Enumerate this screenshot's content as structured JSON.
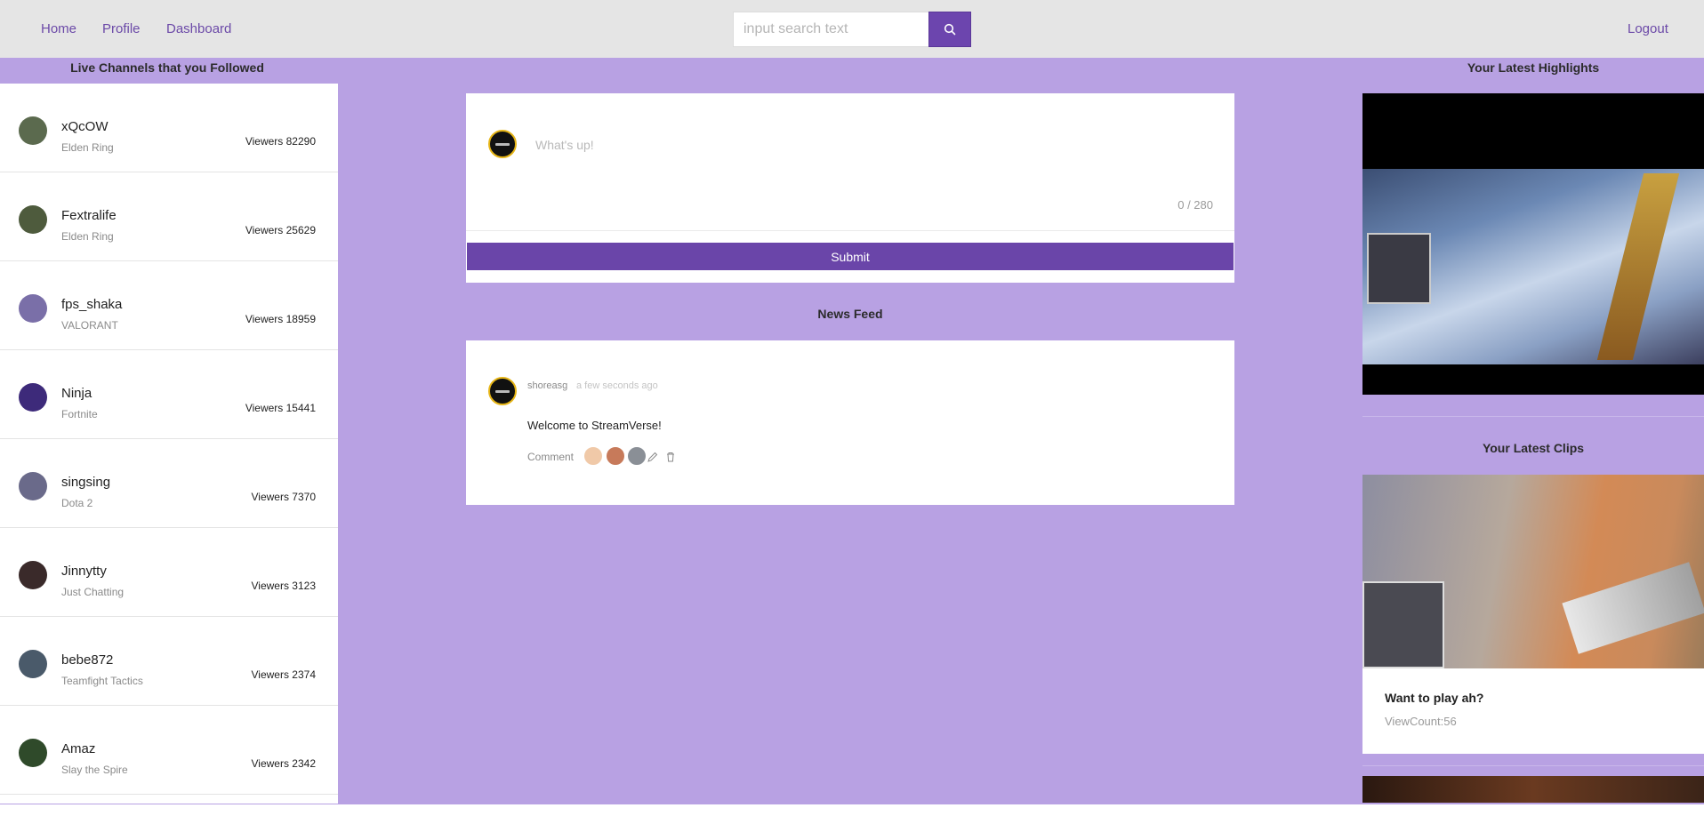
{
  "nav": {
    "home": "Home",
    "profile": "Profile",
    "dashboard": "Dashboard",
    "logout": "Logout",
    "search_placeholder": "input search text",
    "search_icon": "search-icon"
  },
  "sidebar": {
    "title": "Live Channels that you Followed",
    "channels": [
      {
        "name": "xQcOW",
        "game": "Elden Ring",
        "viewers": "Viewers 82290",
        "avatar_color": "#5b6a4e"
      },
      {
        "name": "Fextralife",
        "game": "Elden Ring",
        "viewers": "Viewers 25629",
        "avatar_color": "#4e5b3d"
      },
      {
        "name": "fps_shaka",
        "game": "VALORANT",
        "viewers": "Viewers 18959",
        "avatar_color": "#7a6fa8"
      },
      {
        "name": "Ninja",
        "game": "Fortnite",
        "viewers": "Viewers 15441",
        "avatar_color": "#3d2a7a"
      },
      {
        "name": "singsing",
        "game": "Dota 2",
        "viewers": "Viewers 7370",
        "avatar_color": "#6a6a8a"
      },
      {
        "name": "Jinnytty",
        "game": "Just Chatting",
        "viewers": "Viewers 3123",
        "avatar_color": "#3a2a2a"
      },
      {
        "name": "bebe872",
        "game": "Teamfight Tactics",
        "viewers": "Viewers 2374",
        "avatar_color": "#4a5a6a"
      },
      {
        "name": "Amaz",
        "game": "Slay the Spire",
        "viewers": "Viewers 2342",
        "avatar_color": "#2f4a2a"
      }
    ]
  },
  "composer": {
    "placeholder": "What's up!",
    "char_count": "0 / 280",
    "submit_label": "Submit"
  },
  "feed": {
    "title": "News Feed",
    "posts": [
      {
        "author": "shoreasg",
        "time": "a few seconds ago",
        "body": "Welcome to StreamVerse!",
        "comment_label": "Comment"
      }
    ]
  },
  "right": {
    "highlights_title": "Your Latest Highlights",
    "clips_title": "Your Latest Clips",
    "clip": {
      "title": "Want to play ah?",
      "views": "ViewCount:56"
    }
  },
  "colors": {
    "accent": "#6a45a9",
    "background": "#b8a1e3",
    "header": "#e5e5e5"
  }
}
